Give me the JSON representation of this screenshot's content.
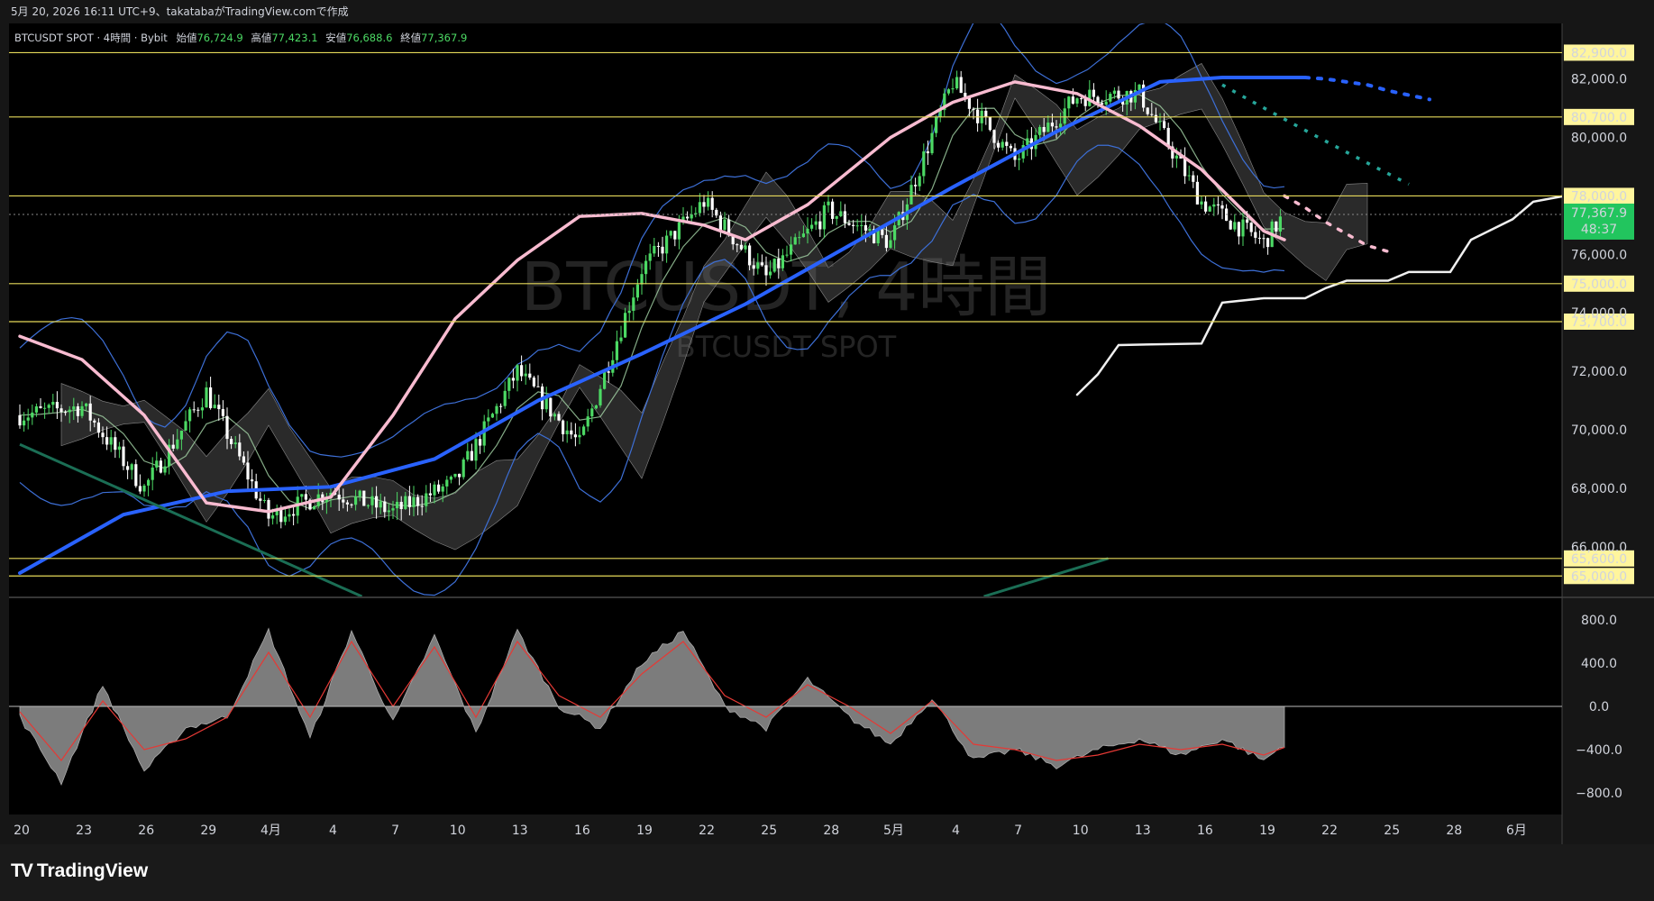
{
  "header": {
    "text": "5月 20, 2026 16:11 UTC+9、takatabaがTradingView.comで作成"
  },
  "legend": {
    "symbol": "BTCUSDT SPOT · 4時間 · Bybit",
    "open_label": "始値",
    "open": "76,724.9",
    "high_label": "高値",
    "high": "77,423.1",
    "low_label": "安値",
    "low": "76,688.6",
    "close_label": "終値",
    "close": "77,367.9"
  },
  "watermark": {
    "main": "BTCUSDT, 4時間",
    "sub": "BTCUSDT SPOT"
  },
  "current_price": {
    "value": "77,367.9",
    "countdown": "48:37"
  },
  "footer": {
    "logo": "TradingView"
  },
  "colors": {
    "background": "#000000",
    "panel_bg": "#161616",
    "up": "#4cd964",
    "down": "#ffffff",
    "level_line": "#e6d95a",
    "level_label_bg": "#fff59d",
    "ma_blue": "#2962ff",
    "ma_pink": "#f8bbd0",
    "ma_green": "#a5d6a7",
    "bollinger": "#3d6fd6",
    "purple": "#ce93d8",
    "macd_fill": "#8a8a8a",
    "signal": "#e53935",
    "current_price_bg": "#22c55e"
  },
  "chart_data": [
    {
      "type": "candlestick",
      "title": "BTCUSDT SPOT · 4時間 · Bybit",
      "ylim": [
        64300,
        83900
      ],
      "price_axis_ticks": [
        "82,000.0",
        "80,000.0",
        "76,000.0",
        "74,000.0",
        "72,000.0",
        "70,000.0",
        "68,000.0",
        "66,000.0"
      ],
      "time_axis_ticks": [
        "20",
        "23",
        "26",
        "29",
        "4月",
        "4",
        "7",
        "10",
        "13",
        "16",
        "19",
        "22",
        "25",
        "28",
        "5月",
        "4",
        "7",
        "10",
        "13",
        "16",
        "19",
        "22",
        "25",
        "28",
        "6月"
      ],
      "horizontal_levels": [
        82900,
        80700,
        78000,
        75000,
        73700,
        65600,
        65000
      ],
      "horizontal_level_labels": [
        "82,900.0",
        "80,700.0",
        "78,000.0",
        "75,000.0",
        "73,700.0",
        "65,600.0",
        "65,000.0"
      ],
      "last_close": 77367.9,
      "ohlc_last": {
        "open": 76724.9,
        "high": 77423.1,
        "low": 76688.6,
        "close": 77367.9
      },
      "series": [
        {
          "name": "close_path_approx",
          "x": [
            0,
            3,
            6,
            9,
            12,
            15,
            18,
            21,
            24,
            27,
            30,
            33,
            36,
            39,
            42,
            45,
            48,
            51,
            54,
            57,
            60,
            61
          ],
          "values": [
            70500,
            70800,
            68000,
            71300,
            67000,
            67900,
            67200,
            68200,
            72000,
            69500,
            75500,
            77800,
            75200,
            77500,
            76400,
            81900,
            79200,
            81400,
            81500,
            77800,
            76400,
            77368
          ]
        },
        {
          "name": "ma_blue",
          "x": [
            0,
            5,
            10,
            15,
            20,
            25,
            30,
            35,
            40,
            45,
            50,
            55,
            58,
            61,
            62
          ],
          "values": [
            65100,
            67100,
            67900,
            68050,
            69000,
            71000,
            72600,
            74300,
            76300,
            78300,
            80200,
            81900,
            82050,
            82050,
            82050
          ]
        },
        {
          "name": "ma_blue_projection",
          "x": [
            62,
            63,
            64,
            65,
            66,
            67,
            68
          ],
          "values": [
            82050,
            82000,
            81900,
            81800,
            81600,
            81450,
            81300
          ]
        },
        {
          "name": "ma_pink",
          "x": [
            0,
            3,
            6,
            9,
            12,
            15,
            18,
            21,
            24,
            27,
            30,
            33,
            35,
            38,
            42,
            45,
            48,
            51,
            54,
            57,
            60,
            61
          ],
          "values": [
            73200,
            72400,
            70500,
            67500,
            67200,
            67700,
            70500,
            73800,
            75800,
            77300,
            77400,
            77000,
            76500,
            77700,
            80000,
            81200,
            81900,
            81500,
            80400,
            78900,
            76800,
            76500
          ]
        },
        {
          "name": "ma_pink_projection",
          "x": [
            61,
            62,
            63,
            64,
            65,
            66
          ],
          "values": [
            78000,
            77600,
            77100,
            76700,
            76300,
            76100
          ]
        },
        {
          "name": "white_projection",
          "x": [
            51,
            52,
            53,
            57,
            58,
            60,
            62,
            63,
            64,
            66,
            67,
            69,
            70,
            72,
            73,
            74.5
          ],
          "values": [
            71200,
            71900,
            72900,
            72950,
            74350,
            74500,
            74500,
            74850,
            75100,
            75100,
            75400,
            75400,
            76500,
            77200,
            77800,
            78000
          ]
        }
      ]
    },
    {
      "type": "area",
      "title": "",
      "ylim": [
        -1000,
        1000
      ],
      "axis_ticks": [
        "800.0",
        "400.0",
        "0.0",
        "−400.0",
        "−800.0"
      ],
      "series": [
        {
          "name": "histogram",
          "x": [
            0,
            2,
            4,
            6,
            8,
            10,
            12,
            14,
            16,
            18,
            20,
            22,
            24,
            26,
            28,
            30,
            32,
            34,
            36,
            38,
            40,
            42,
            44,
            46,
            48,
            50,
            52,
            54,
            56,
            58,
            60,
            61
          ],
          "values": [
            -100,
            -700,
            200,
            -600,
            -200,
            -100,
            700,
            -300,
            700,
            -150,
            650,
            -250,
            700,
            0,
            -200,
            400,
            700,
            0,
            -200,
            250,
            -100,
            -350,
            80,
            -500,
            -400,
            -550,
            -400,
            -300,
            -450,
            -300,
            -500,
            -350
          ]
        },
        {
          "name": "signal",
          "x": [
            0,
            2,
            4,
            6,
            8,
            10,
            12,
            14,
            16,
            18,
            20,
            22,
            24,
            26,
            28,
            30,
            32,
            34,
            36,
            38,
            40,
            42,
            44,
            46,
            48,
            50,
            52,
            54,
            56,
            58,
            60,
            61
          ],
          "values": [
            -50,
            -500,
            50,
            -400,
            -300,
            -100,
            500,
            -100,
            600,
            0,
            550,
            -100,
            600,
            100,
            -100,
            300,
            600,
            100,
            -100,
            200,
            0,
            -250,
            50,
            -350,
            -400,
            -500,
            -450,
            -350,
            -400,
            -350,
            -450,
            -380
          ]
        }
      ]
    }
  ]
}
